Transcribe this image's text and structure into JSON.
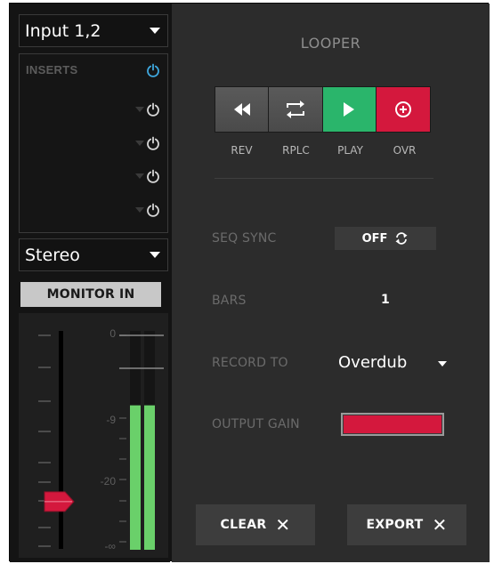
{
  "input_select": {
    "value": "Input 1,2"
  },
  "inserts": {
    "label": "INSERTS",
    "slots": [
      {
        "power": "on"
      },
      {
        "power": "off"
      },
      {
        "power": "off"
      },
      {
        "power": "off"
      },
      {
        "power": "off"
      }
    ]
  },
  "channel_mode": {
    "value": "Stereo"
  },
  "monitor": {
    "label": "MONITOR IN"
  },
  "meter": {
    "scale_labels": [
      "0",
      "-9",
      "-20",
      "-∞"
    ],
    "fader_level": 0.22,
    "meter_left_level": 0.66,
    "meter_right_level": 0.66
  },
  "looper": {
    "title": "LOOPER",
    "transport": [
      {
        "label": "REV",
        "icon": "rewind-icon"
      },
      {
        "label": "RPLC",
        "icon": "replace-loop-icon"
      },
      {
        "label": "PLAY",
        "icon": "play-icon"
      },
      {
        "label": "OVR",
        "icon": "overdub-record-icon"
      }
    ],
    "seq_sync": {
      "label": "SEQ SYNC",
      "value": "OFF",
      "icon": "sync-icon"
    },
    "bars": {
      "label": "BARS",
      "value": "1"
    },
    "record_to": {
      "label": "RECORD TO",
      "value": "Overdub"
    },
    "output_gain": {
      "label": "OUTPUT GAIN",
      "level": 1.0
    },
    "clear": {
      "label": "CLEAR",
      "icon": "close-icon"
    },
    "export": {
      "label": "EXPORT",
      "icon": "close-icon"
    }
  },
  "colors": {
    "play": "#2ab56b",
    "record": "#d4183d",
    "power_on": "#3fa9e0",
    "meter": "#6ad06a"
  }
}
